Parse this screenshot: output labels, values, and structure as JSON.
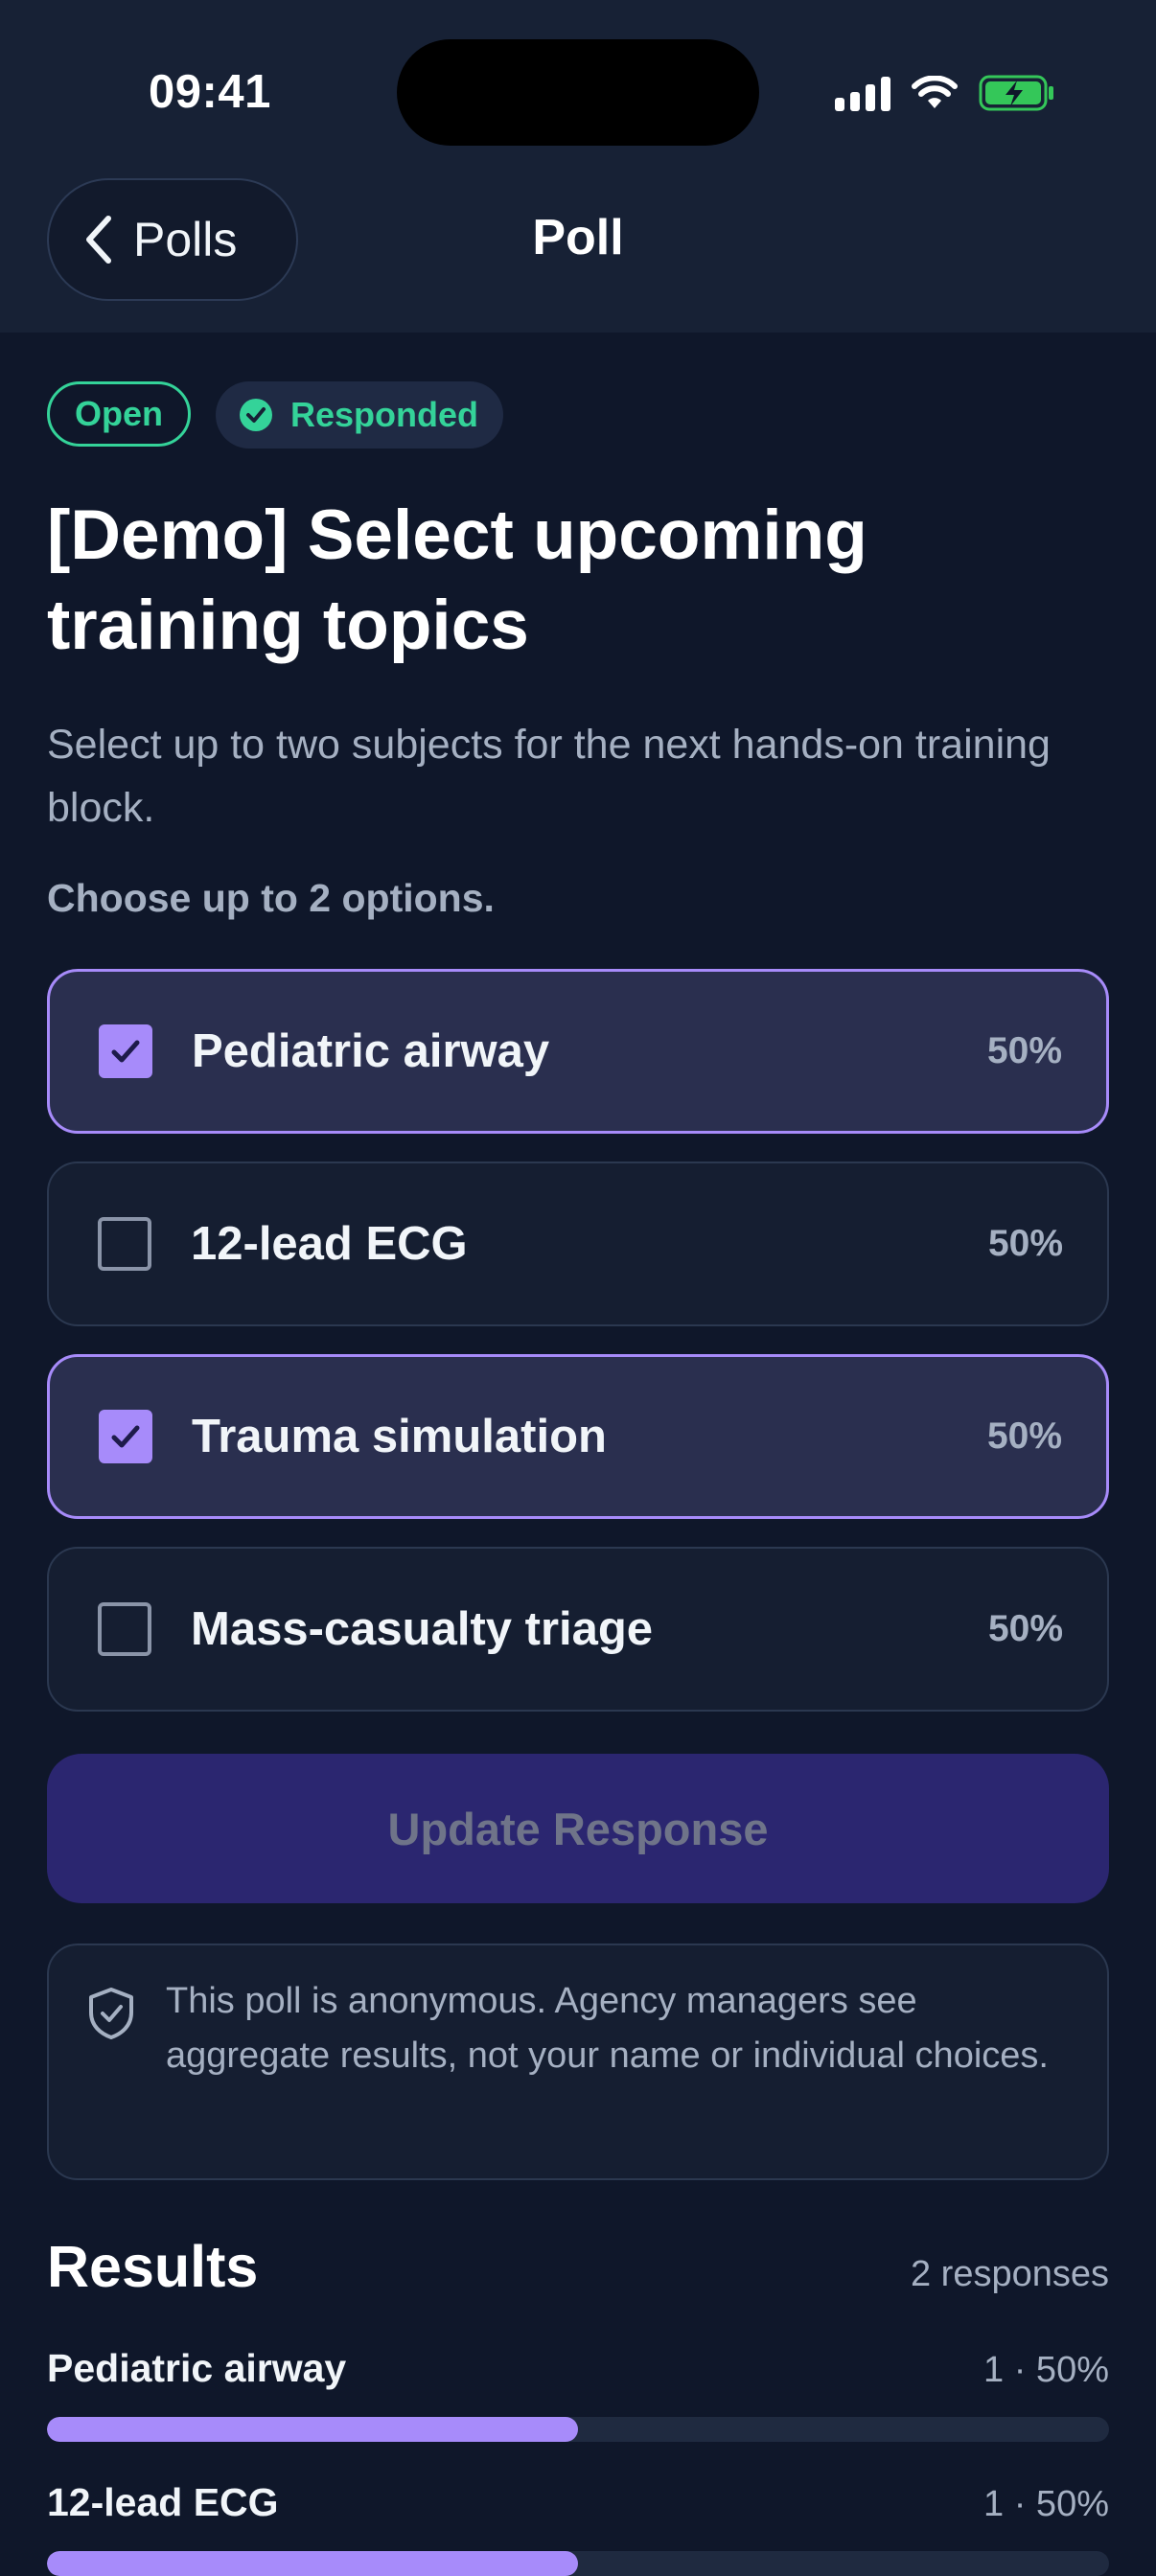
{
  "status_bar": {
    "time": "09:41"
  },
  "nav": {
    "back_label": "Polls",
    "title": "Poll"
  },
  "badges": {
    "open": "Open",
    "responded": "Responded"
  },
  "poll": {
    "title": "[Demo] Select upcoming training topics",
    "description": "Select up to two subjects for the next hands-on training block.",
    "instructions": "Choose up to 2 options.",
    "options": [
      {
        "label": "Pediatric airway",
        "percent": "50%",
        "selected": true
      },
      {
        "label": "12-lead ECG",
        "percent": "50%",
        "selected": false
      },
      {
        "label": "Trauma simulation",
        "percent": "50%",
        "selected": true
      },
      {
        "label": "Mass-casualty triage",
        "percent": "50%",
        "selected": false
      }
    ],
    "update_button": "Update Response",
    "anonymity_notice": "This poll is anonymous. Agency managers see aggregate results, not your name or individual choices."
  },
  "results": {
    "heading": "Results",
    "response_count": "2 responses",
    "items": [
      {
        "label": "Pediatric airway",
        "stat": "1 · 50%",
        "fraction": 0.5
      },
      {
        "label": "12-lead ECG",
        "stat": "1 · 50%",
        "fraction": 0.5
      }
    ]
  },
  "colors": {
    "background": "#0f172a",
    "accent": "#a78bfa",
    "success": "#34d399",
    "button": "#2b2670"
  }
}
